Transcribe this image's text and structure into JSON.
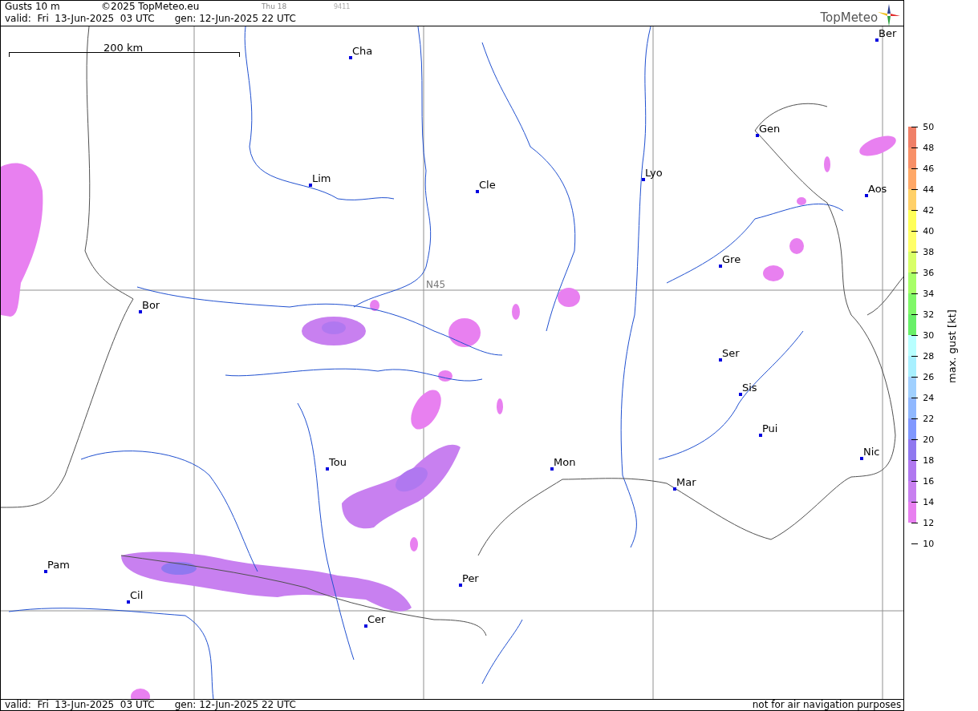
{
  "header": {
    "title": "Gusts 10 m",
    "copyright": "©2025 TopMeteo.eu",
    "day": "Thu 18",
    "code": "9411",
    "valid": "valid:  Fri  13-Jun-2025  03 UTC",
    "generated": "gen: 12-Jun-2025 22 UTC",
    "logo": "TopMeteo"
  },
  "map": {
    "scale_label": "200 km",
    "grid_label": "N45",
    "cities": [
      "Cha",
      "Lim",
      "Cle",
      "Lyo",
      "Gen",
      "Ber",
      "Aos",
      "Gre",
      "Bor",
      "Ser",
      "Sis",
      "Pui",
      "Nic",
      "Tou",
      "Mon",
      "Mar",
      "Pam",
      "Cil",
      "Per",
      "Cer"
    ]
  },
  "legend": {
    "title": "max. gust [kt]",
    "ticks": [
      "50",
      "48",
      "46",
      "44",
      "42",
      "40",
      "38",
      "36",
      "34",
      "32",
      "30",
      "28",
      "26",
      "24",
      "22",
      "20",
      "18",
      "16",
      "14",
      "12",
      "10"
    ],
    "bands": [
      {
        "color": "#f08068"
      },
      {
        "color": "#f89068"
      },
      {
        "color": "#ffa868"
      },
      {
        "color": "#ffd068"
      },
      {
        "color": "#ffff58"
      },
      {
        "color": "#ffff68"
      },
      {
        "color": "#d8ff68"
      },
      {
        "color": "#a8ff68"
      },
      {
        "color": "#80f868"
      },
      {
        "color": "#68f068"
      },
      {
        "color": "#b8ffff"
      },
      {
        "color": "#a8f0ff"
      },
      {
        "color": "#a0d0ff"
      },
      {
        "color": "#90b8ff"
      },
      {
        "color": "#8098ff"
      },
      {
        "color": "#9078f0"
      },
      {
        "color": "#b078f0"
      },
      {
        "color": "#c880f0"
      },
      {
        "color": "#e880f0"
      }
    ]
  },
  "footer": {
    "valid": "valid:  Fri  13-Jun-2025  03 UTC",
    "generated": "gen: 12-Jun-2025 22 UTC",
    "notice": "not for air navigation purposes"
  }
}
